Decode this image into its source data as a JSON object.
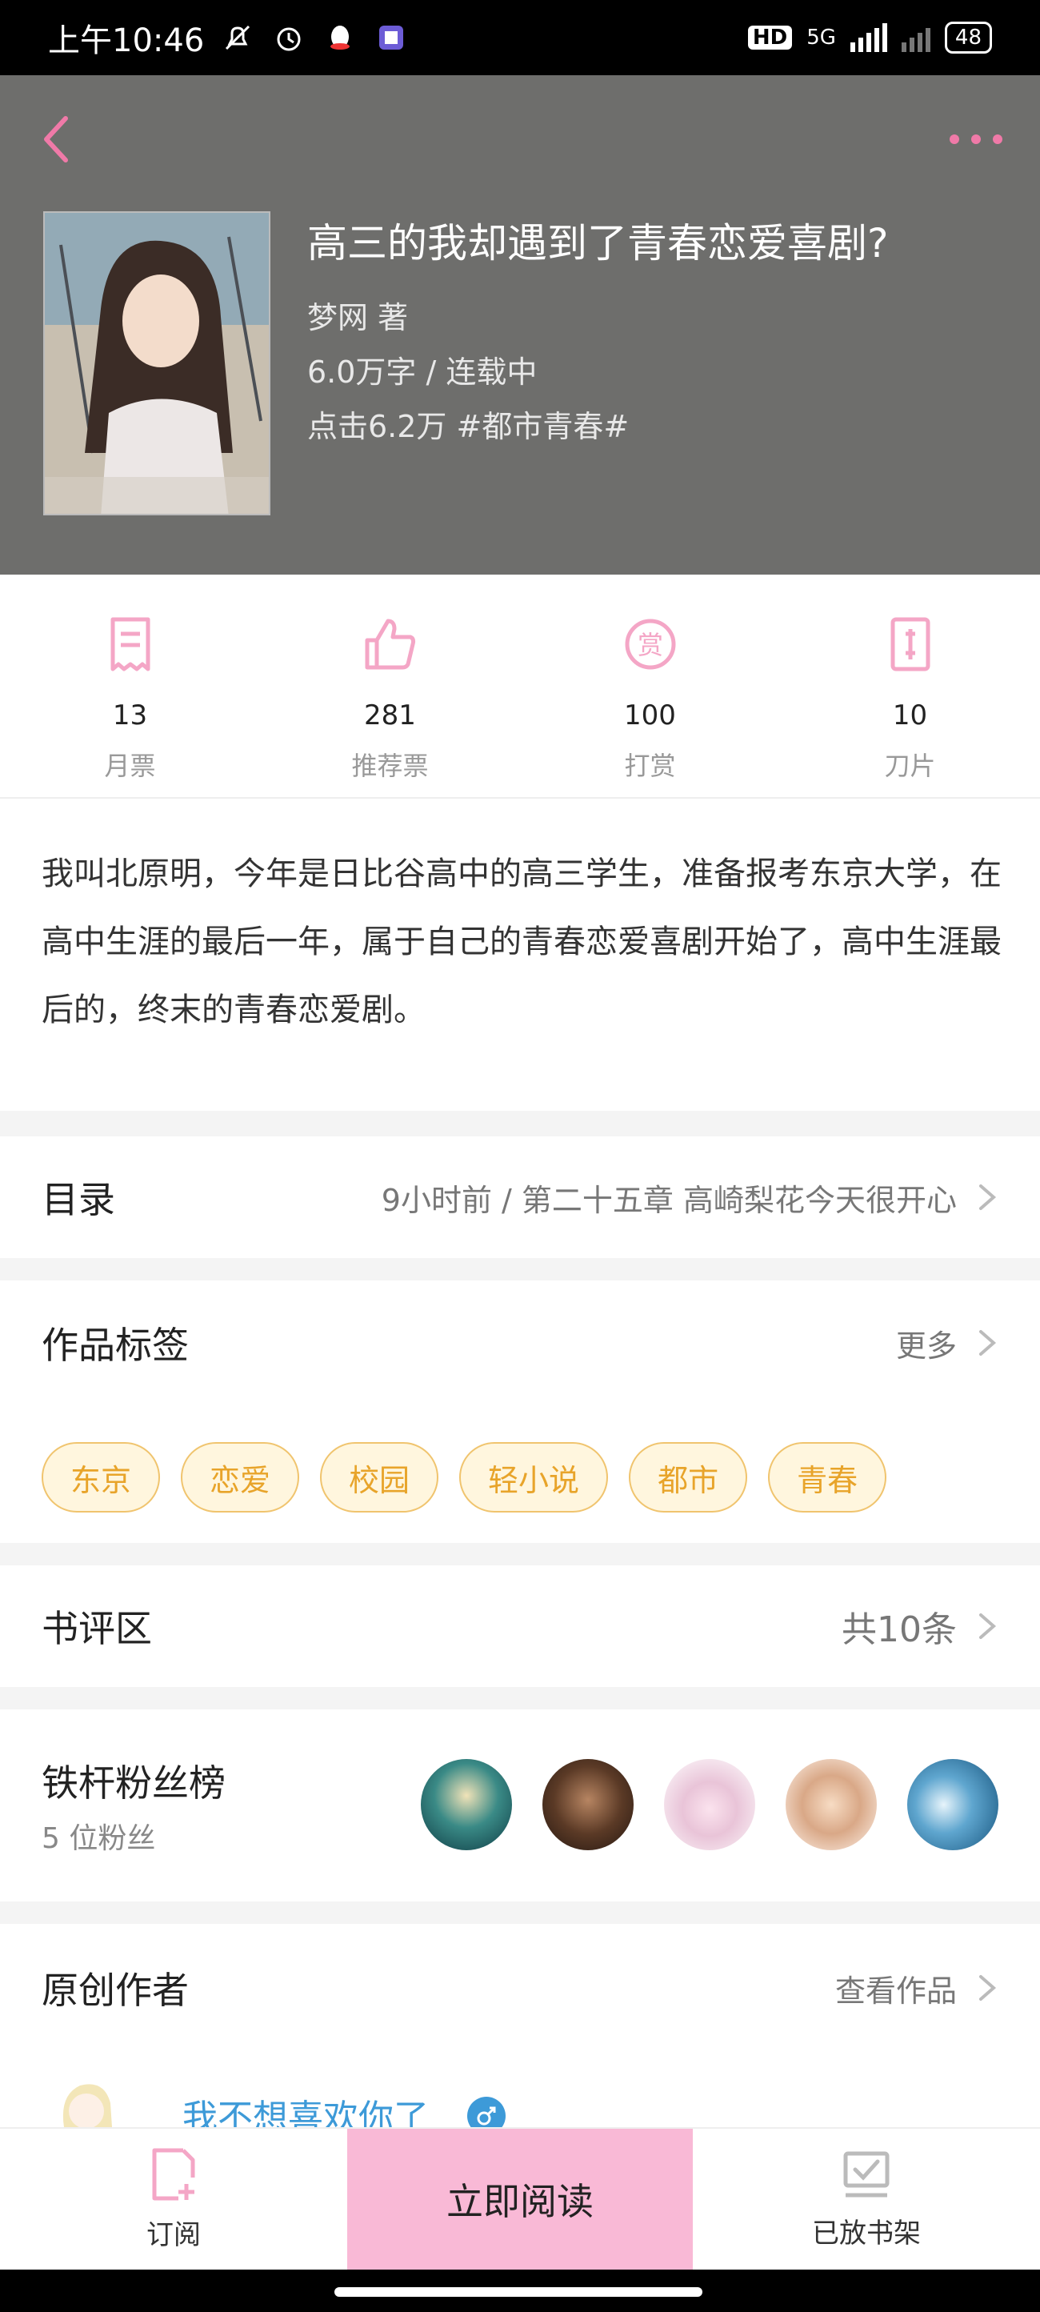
{
  "status_bar": {
    "time": "上午10:46",
    "network": "5G",
    "hd": "HD",
    "battery": "48"
  },
  "book": {
    "title": "高三的我却遇到了青春恋爱喜剧?",
    "author_line": "梦网  著",
    "words_status": "6.0万字 / 连载中",
    "clicks_genre": "点击6.2万   #都市青春#"
  },
  "stats": [
    {
      "value": "13",
      "label": "月票",
      "icon": "ticket-icon"
    },
    {
      "value": "281",
      "label": "推荐票",
      "icon": "thumbs-up-icon"
    },
    {
      "value": "100",
      "label": "打赏",
      "icon": "reward-icon"
    },
    {
      "value": "10",
      "label": "刀片",
      "icon": "blade-icon"
    }
  ],
  "intro": "我叫北原明，今年是日比谷高中的高三学生，准备报考东京大学，在高中生涯的最后一年，属于自己的青春恋爱喜剧开始了，高中生涯最后的，终末的青春恋爱剧。",
  "catalog": {
    "title": "目录",
    "latest": "9小时前 / 第二十五章 高崎梨花今天很开心"
  },
  "tags_section": {
    "title": "作品标签",
    "more": "更多",
    "tags": [
      "东京",
      "恋爱",
      "校园",
      "轻小说",
      "都市",
      "青春"
    ]
  },
  "reviews": {
    "title": "书评区",
    "count": "共10条"
  },
  "fans": {
    "title": "铁杆粉丝榜",
    "count": "5 位粉丝"
  },
  "author": {
    "title": "原创作者",
    "view_works": "查看作品",
    "name": "我不想喜欢你了"
  },
  "bottom_bar": {
    "subscribe": "订阅",
    "read_now": "立即阅读",
    "on_shelf": "已放书架"
  },
  "colors": {
    "accent_pink": "#f07aa8",
    "tag_orange": "#e8a42a",
    "hero_gray": "#6e6e6c",
    "link_blue": "#3d9ad8"
  }
}
